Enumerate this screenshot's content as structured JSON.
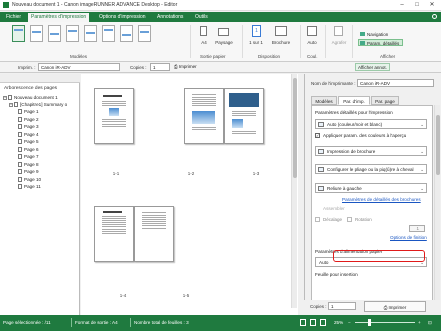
{
  "window": {
    "title": "Nouveau document 1 - Canon imageRUNNER ADVANCE Desktop - Editor",
    "controls": [
      "–",
      "□",
      "✕"
    ]
  },
  "menu": {
    "tabs": [
      "Fichier",
      "Paramètres d'impression",
      "Options d'impression",
      "Annotations",
      "Outils"
    ],
    "active": "Paramètres d'impression"
  },
  "ribbon": {
    "groups": {
      "modeles": "Modèles",
      "sortie_papier": "Sortie papier",
      "disposition": "Disposition",
      "coul": "Coul.",
      "afficher": "Afficher"
    },
    "orientation_a4": "A4",
    "paysage": "Paysage",
    "layout_value": "1",
    "layout_label": "1 sur 1",
    "brochure": "Brochure",
    "auto": "Auto",
    "agrafer": "Agrafer",
    "navigation": "Navigation",
    "param_details": "Param. détaillés"
  },
  "toolbar": {
    "imprim_label": "Imprim. :",
    "printer": "Canon iR-ADV",
    "copies_label": "Copies :",
    "copies_value": "1",
    "imprimer": "Imprimer",
    "afficher_annot": "Afficher annot."
  },
  "left_panel": {
    "title": "Arborescence des pages",
    "items": [
      {
        "label": "Nouveau document 1",
        "level": 0
      },
      {
        "label": "[Chapitre1] Summary o",
        "level": 1
      },
      {
        "label": "Page 1",
        "level": 2
      },
      {
        "label": "Page 2",
        "level": 2
      },
      {
        "label": "Page 3",
        "level": 2
      },
      {
        "label": "Page 4",
        "level": 2
      },
      {
        "label": "Page 5",
        "level": 2
      },
      {
        "label": "Page 6",
        "level": 2
      },
      {
        "label": "Page 7",
        "level": 2
      },
      {
        "label": "Page 8",
        "level": 2
      },
      {
        "label": "Page 9",
        "level": 2
      },
      {
        "label": "Page 10",
        "level": 2
      },
      {
        "label": "Page 11",
        "level": 2
      }
    ]
  },
  "pages": {
    "labels": [
      "1-1",
      "1-2",
      "1-3",
      "1-4",
      "1-5"
    ]
  },
  "right_panel": {
    "printer_label": "Nom de l'imprimante :",
    "printer_value": "Canon iR-ADV",
    "tabs": [
      "Modèles",
      "Par. d'imp.",
      "Par. page"
    ],
    "active_tab": "Par. d'imp.",
    "section_title": "Paramètres détaillés pour l'impression",
    "color_mode": "Auto (couleur/noir et blanc)",
    "apply_color_check": "Appliquer param. des couleurs à l'aperçu",
    "brochure": "Impression de brochure",
    "pliage": "Configurer le pliage ou la piq(û)re à cheval",
    "reliure": "Reliure à gauche",
    "detail_link": "Paramètres de détaillés des brochures",
    "assembler": "Assembler",
    "decalage": "Décalage",
    "rotation": "Rotation",
    "spin_value": "1",
    "finition_link": "Options de finition",
    "alim_title": "Paramètres d'alimentation papier",
    "alim_value": "Auto",
    "insertion_label": "Feuille pour insertion",
    "copies_label": "Copies :",
    "copies_value": "1",
    "imprimer": "Imprimer"
  },
  "status": {
    "selected": "Page sélectionnée : /11",
    "format": "Format de sortie : A4",
    "sheets": "Nombre total de feuilles : 3",
    "zoom": "25%"
  },
  "colors": {
    "brand_green": "#1f7a3f",
    "highlight_red": "#e01a1a",
    "link_blue": "#1a56c2"
  }
}
